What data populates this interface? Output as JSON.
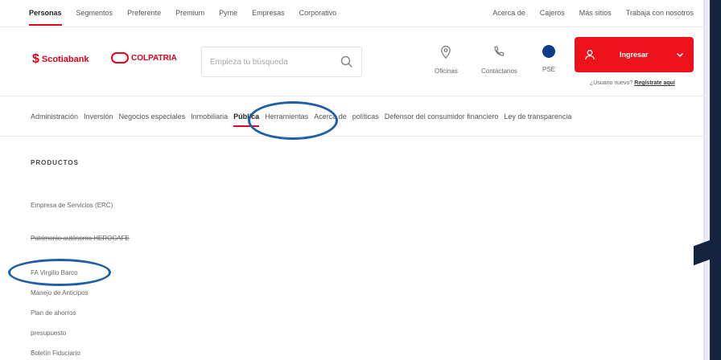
{
  "topbar": {
    "left_links": [
      "Personas",
      "Segmentos",
      "Preferente",
      "Premium",
      "Pyme",
      "Empresas",
      "Corporativo"
    ],
    "right_links": [
      "Acerca de",
      "Cajeros",
      "Más sitios",
      "Trabaja con nosotros"
    ]
  },
  "header": {
    "logo_scotiabank": "Scotiabank",
    "logo_colpatria": "COLPATRIA",
    "search_placeholder": "Empieza tu búsqueda",
    "oficinas": "Oficinas",
    "contactanos": "Contáctanos",
    "pse": "PSE",
    "ingresar": "Ingresar",
    "register_prompt": "¿Usuario nuevo?",
    "register_link": "Regístrate aquí"
  },
  "nav": {
    "items": [
      "Administración",
      "Inversión",
      "Negocios especiales",
      "Inmobiliaria",
      "Pública",
      "Herramientas",
      "Acerca de",
      "políticas",
      "Defensor del consumidor financiero",
      "Ley de transparencia"
    ],
    "active": "Pública"
  },
  "content": {
    "products_title": "PRODUCTOS",
    "products": [
      "Empresa de Servicios (ERC)",
      "Patrimonio autónomo HEROCAFE",
      "FA Virgilio Barco",
      "Manejo de Anticipos",
      "Plan de ahorros",
      "presupuesto",
      "Boletín Fiduciario"
    ]
  },
  "colors": {
    "brand_red": "#e3001b",
    "highlight_blue": "#1f5fa8",
    "frame_navy": "#1b2a4a",
    "accent_yellow": "#f2c230"
  }
}
